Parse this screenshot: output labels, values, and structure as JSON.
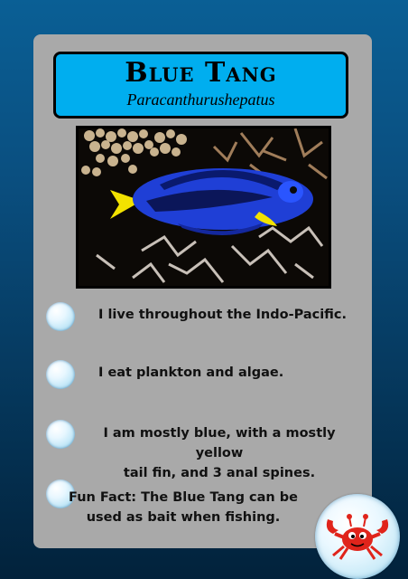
{
  "card": {
    "title": "Blue Tang",
    "subtitle": "Paracanthurushepatus"
  },
  "facts": [
    {
      "lines": [
        "I live throughout the Indo-Pacific."
      ]
    },
    {
      "lines": [
        "I eat plankton and algae."
      ]
    },
    {
      "lines": [
        "I am mostly blue, with a mostly yellow",
        "tail fin, and 3 anal spines."
      ]
    },
    {
      "lines": [
        "Fun Fact: The Blue Tang can be",
        "used as bait when fishing."
      ]
    }
  ],
  "icons": {
    "fact_marker": "bubble-icon",
    "badge": "crab-icon"
  },
  "colors": {
    "title_box": "#00aeef",
    "card": "#a9a9a9",
    "fish_body": "#1f3fd6",
    "fish_tail": "#f2e200"
  }
}
